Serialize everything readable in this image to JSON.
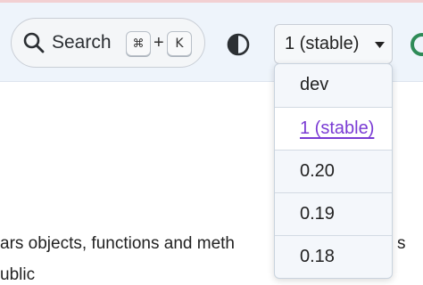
{
  "header": {
    "search": {
      "label": "Search",
      "shortcut_modifier": "⌘",
      "shortcut_plus": "+",
      "shortcut_key": "K"
    },
    "version": {
      "selected": "1 (stable)"
    }
  },
  "version_menu": {
    "items": [
      {
        "label": "dev",
        "active": false
      },
      {
        "label": "1 (stable)",
        "active": true
      },
      {
        "label": "0.20",
        "active": false
      },
      {
        "label": "0.19",
        "active": false
      },
      {
        "label": "0.18",
        "active": false
      }
    ]
  },
  "content": {
    "line1": "ars objects, functions and meth",
    "line1_tail": "s",
    "line2": "ublic"
  },
  "colors": {
    "header_bg": "#eef4fb",
    "active_link": "#7a3bd4",
    "accent_bar": "#f2d0d2",
    "edge_icon": "#2e8b57"
  },
  "icons": [
    "search-icon",
    "contrast-icon",
    "chevron-down-icon",
    "github-icon"
  ]
}
